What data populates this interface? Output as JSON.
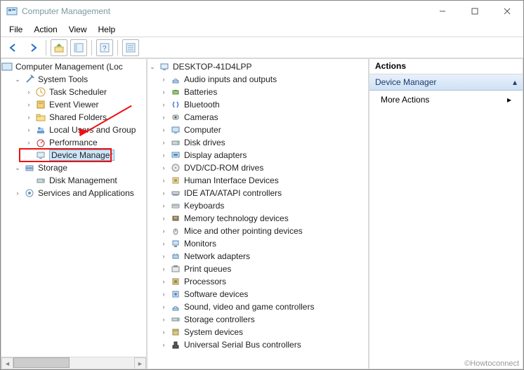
{
  "window": {
    "title": "Computer Management"
  },
  "menubar": [
    "File",
    "Action",
    "View",
    "Help"
  ],
  "actions_panel": {
    "header": "Actions",
    "section": "Device Manager",
    "item": "More Actions"
  },
  "watermark": "©Howtoconnect",
  "left_tree": {
    "root": "Computer Management (Loc",
    "system_tools": "System Tools",
    "task_scheduler": "Task Scheduler",
    "event_viewer": "Event Viewer",
    "shared_folders": "Shared Folders",
    "local_users": "Local Users and Group",
    "performance": "Performance",
    "device_manager": "Device Manager",
    "storage": "Storage",
    "disk_management": "Disk Management",
    "services_apps": "Services and Applications"
  },
  "mid_tree": {
    "root": "DESKTOP-41D4LPP",
    "items": [
      "Audio inputs and outputs",
      "Batteries",
      "Bluetooth",
      "Cameras",
      "Computer",
      "Disk drives",
      "Display adapters",
      "DVD/CD-ROM drives",
      "Human Interface Devices",
      "IDE ATA/ATAPI controllers",
      "Keyboards",
      "Memory technology devices",
      "Mice and other pointing devices",
      "Monitors",
      "Network adapters",
      "Print queues",
      "Processors",
      "Software devices",
      "Sound, video and game controllers",
      "Storage controllers",
      "System devices",
      "Universal Serial Bus controllers"
    ]
  }
}
